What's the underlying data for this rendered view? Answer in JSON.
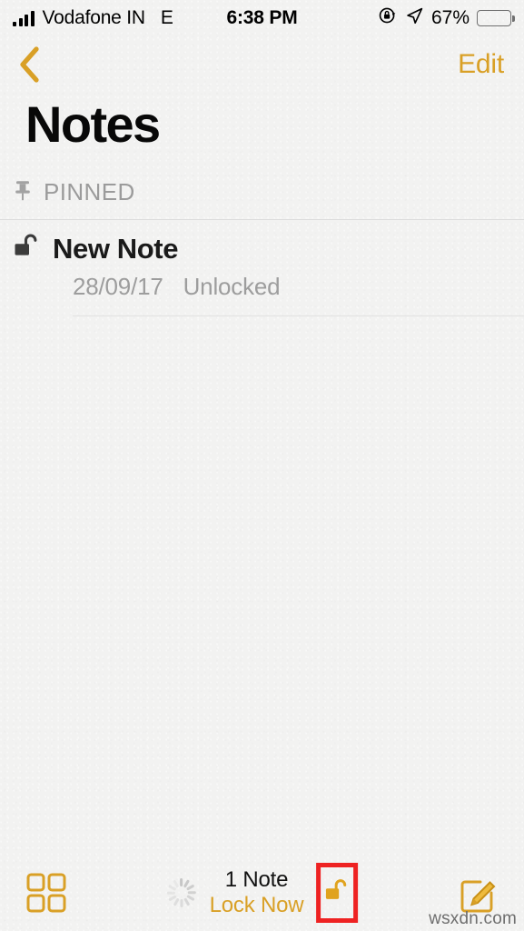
{
  "status_bar": {
    "carrier": "Vodafone IN",
    "network_type": "E",
    "time": "6:38 PM",
    "battery_percent": "67%",
    "battery_level": 67,
    "signal_bars": 4,
    "icons": {
      "signal": "signal-bars-icon",
      "rotation_lock": "rotation-lock-icon",
      "location": "location-arrow-icon",
      "battery": "battery-icon"
    }
  },
  "nav_bar": {
    "back_icon": "chevron-left-icon",
    "edit_label": "Edit"
  },
  "header": {
    "title": "Notes"
  },
  "sections": [
    {
      "icon": "pin-icon",
      "label": "PINNED",
      "notes": [
        {
          "icon": "unlocked-padlock-icon",
          "title": "New Note",
          "date": "28/09/17",
          "status": "Unlocked"
        }
      ]
    }
  ],
  "toolbar": {
    "grid_icon": "grid-view-icon",
    "spinner_icon": "activity-spinner-icon",
    "note_count": "1 Note",
    "lock_now_label": "Lock Now",
    "lock_icon": "unlocked-padlock-icon",
    "compose_icon": "compose-note-icon"
  },
  "annotation": {
    "highlight_color": "#ee2222",
    "target": "unlock-toolbar-button"
  },
  "watermark": "wsxdn.com",
  "colors": {
    "accent": "#d9a026",
    "background": "#f2f2f1",
    "title_text": "#080808",
    "secondary_text": "#9d9d9d",
    "separator": "#dcdcdc"
  }
}
